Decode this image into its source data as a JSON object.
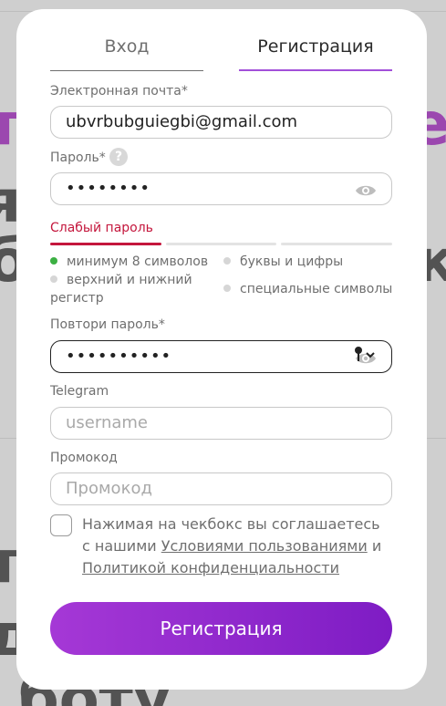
{
  "tabs": {
    "login": "Вход",
    "register": "Регистрация"
  },
  "email": {
    "label": "Электронная почта*",
    "value": "ubvrbubguiegbi@gmail.com"
  },
  "password": {
    "label": "Пароль*",
    "help": "?",
    "value": "••••••••"
  },
  "strength": {
    "text": "Слабый пароль",
    "level": 0.33,
    "accent": "#c4163c"
  },
  "rules": {
    "min_length": "минимум 8 символов",
    "letters_digits": "буквы и цифры",
    "case": "верхний и нижний регистр",
    "special": "специальные символы"
  },
  "repeat": {
    "label": "Повтори пароль*",
    "value": "••••••••••"
  },
  "telegram": {
    "label": "Telegram",
    "placeholder": "username"
  },
  "promo": {
    "label": "Промокод",
    "placeholder": "Промокод"
  },
  "agreement": {
    "text": "Нажимая на чекбокс вы соглашаетесь с нашими",
    "terms_link": "Условиями пользованиями",
    "and": "и",
    "privacy_link": "Политикой конфиденциальности"
  },
  "submit_label": "Регистрация",
  "colors": {
    "brand": "#a538d6",
    "ok": "#3cb043"
  }
}
